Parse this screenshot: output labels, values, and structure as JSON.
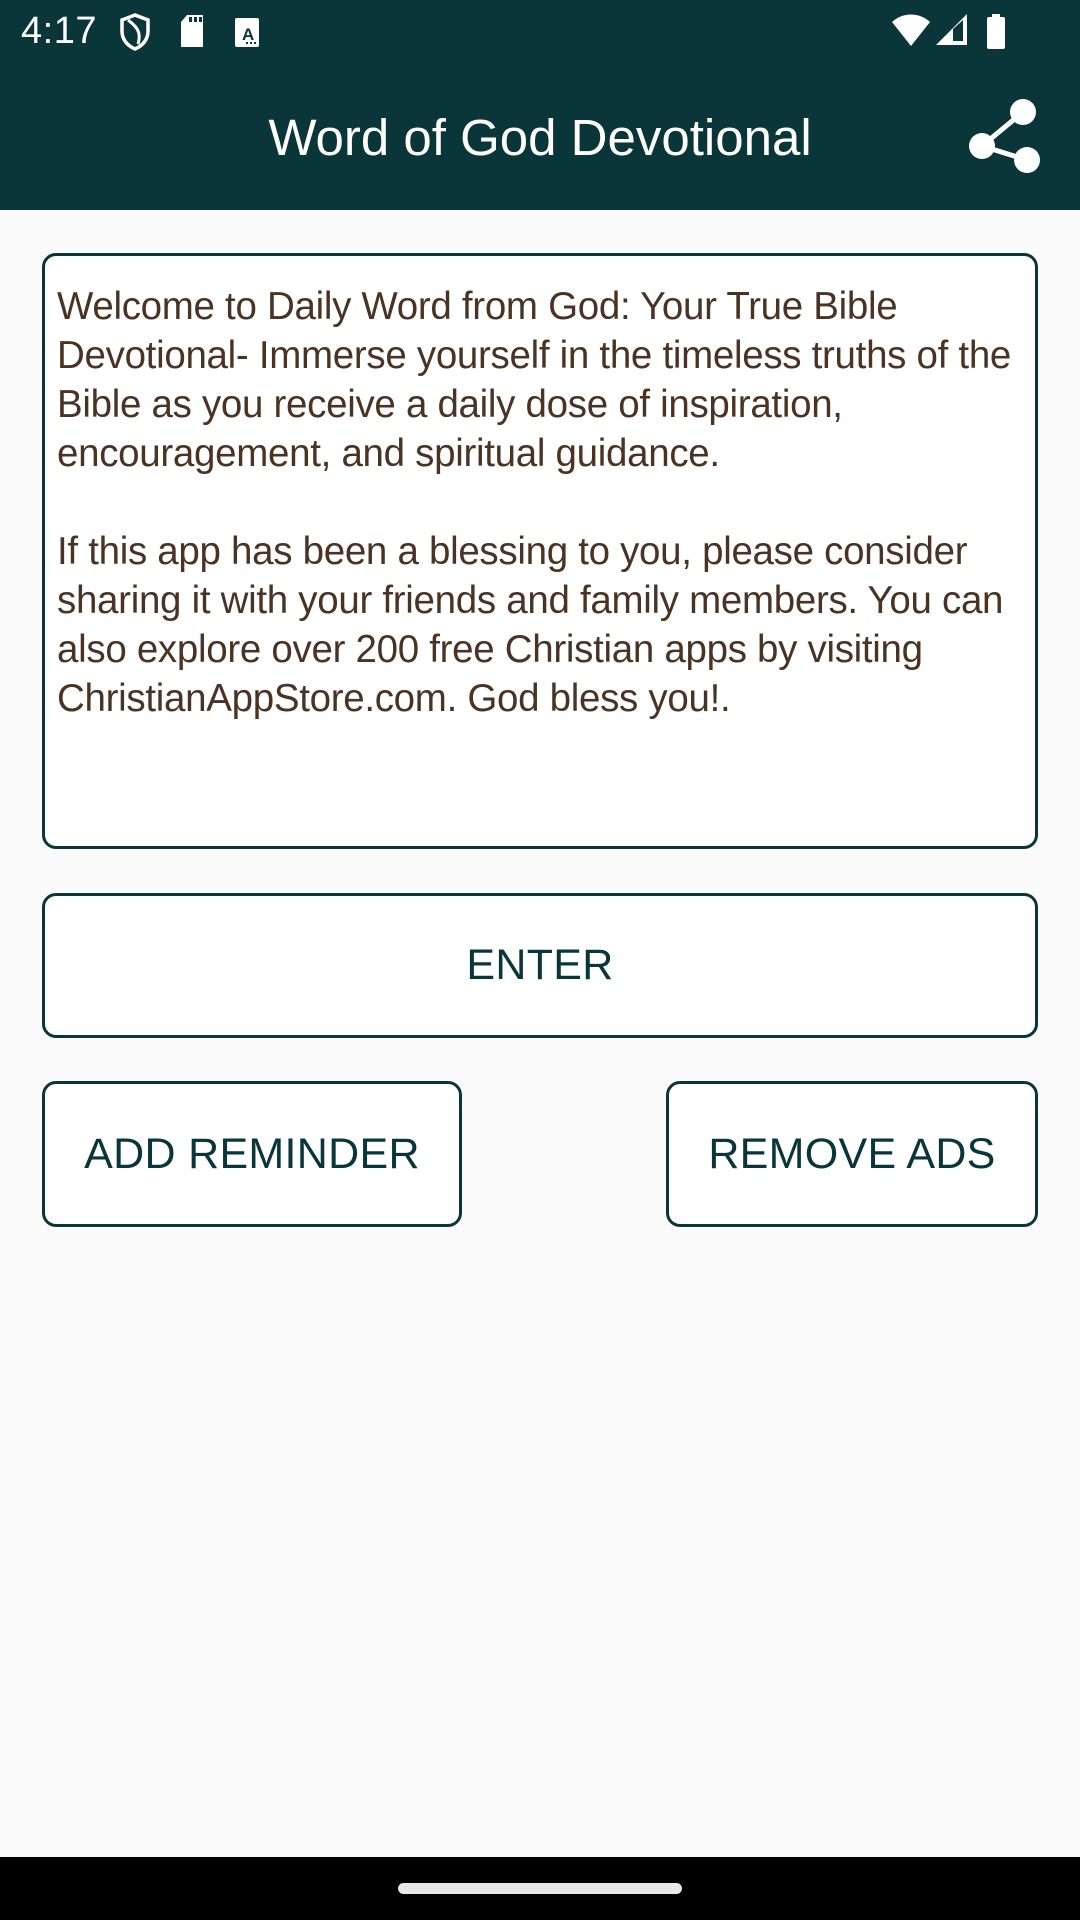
{
  "status_bar": {
    "time": "4:17",
    "left_icons": [
      "shield-icon",
      "sd-card-icon",
      "keyboard-a-icon"
    ],
    "right_icons": [
      "wifi-icon",
      "cell-signal-icon",
      "battery-icon"
    ]
  },
  "app_bar": {
    "title": "Word of God Devotional",
    "action_icon": "share-icon",
    "background_color": "#0b3639"
  },
  "description": {
    "paragraphs": [
      "Welcome to Daily Word from God: Your True Bible Devotional- Immerse yourself in the timeless truths of the Bible as you receive a daily dose of inspiration, encouragement, and spiritual guidance.",
      "If this app has been a blessing to you, please consider sharing it with your friends and family members. You can also explore over 200 free Christian apps by visiting ChristianAppStore.com. God bless you!."
    ],
    "text_color": "#4a3322"
  },
  "buttons": {
    "enter": "ENTER",
    "add_reminder": "ADD REMINDER",
    "remove_ads": "REMOVE ADS"
  },
  "nav_bar": {
    "home_indicator": "home-pill"
  }
}
